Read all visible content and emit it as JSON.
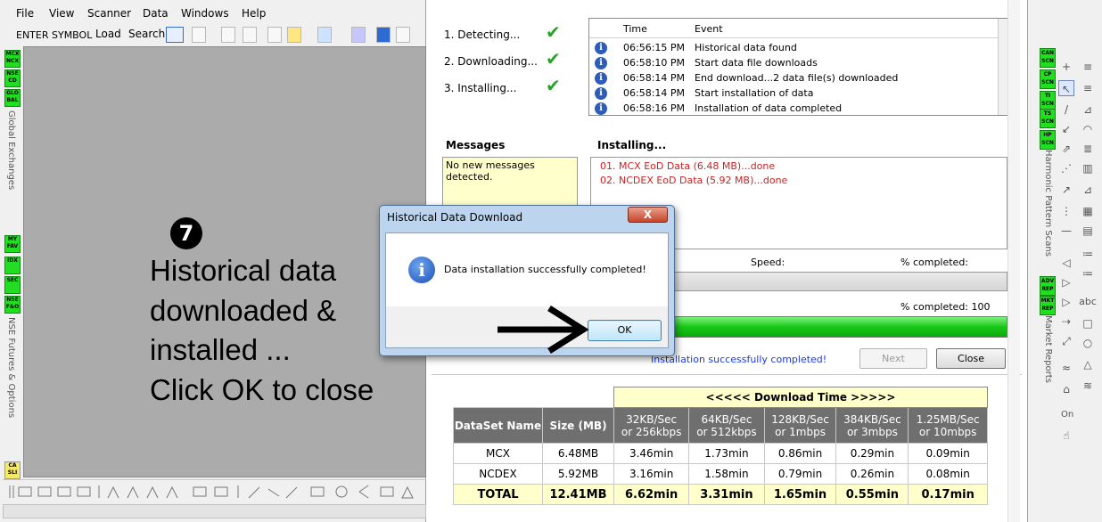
{
  "app": {
    "menu": [
      "File",
      "View",
      "Scanner",
      "Data",
      "Windows",
      "Help"
    ],
    "toolbar": {
      "symbol_input": "ENTER SYMBOL",
      "load": "Load",
      "search": "Search"
    },
    "left_badges": [
      "MCX NCX",
      "NSE CD",
      "GLO BAL",
      "MY FAV",
      "IDX",
      "SEC",
      "NSE F&O",
      "CA SLI"
    ],
    "left_vertical": {
      "global": "Global Exchanges",
      "futures": "NSE Futures & Options"
    }
  },
  "annotation": {
    "step": "7",
    "lines": [
      "Historical data",
      "downloaded &",
      "installed ...",
      "Click OK to close"
    ]
  },
  "installer": {
    "steps": [
      {
        "label": "1.  Detecting..."
      },
      {
        "label": "2.  Downloading..."
      },
      {
        "label": "3.  Installing..."
      }
    ],
    "log_headers": {
      "time": "Time",
      "event": "Event"
    },
    "log": [
      {
        "time": "06:56:15 PM",
        "event": "Historical data found"
      },
      {
        "time": "06:58:10 PM",
        "event": "Start data file downloads"
      },
      {
        "time": "06:58:14 PM",
        "event": "End download...2 data file(s) downloaded"
      },
      {
        "time": "06:58:14 PM",
        "event": "Start installation of data"
      },
      {
        "time": "06:58:16 PM",
        "event": "Installation of data completed"
      }
    ],
    "messages_title": "Messages",
    "messages_text": "No new messages detected.",
    "installing_title": "Installing...",
    "installing_lines": [
      "01. MCX EoD Data (6.48 MB)...done",
      "02. NCDEX EoD Data (5.92 MB)...done"
    ],
    "speed_label": "Speed:",
    "pct_label_1": "% completed:",
    "pct_label_2": "% completed: 100",
    "progress": 1.0,
    "success_msg": "Installation successfully completed!",
    "next": "Next",
    "close": "Close"
  },
  "table": {
    "download_time_header": "<<<<< Download Time >>>>>",
    "col_dataset": "DataSet Name",
    "col_size": "Size (MB)",
    "speeds": [
      [
        "32KB/Sec",
        "or 256kbps"
      ],
      [
        "64KB/Sec",
        "or 512kbps"
      ],
      [
        "128KB/Sec",
        "or 1mbps"
      ],
      [
        "384KB/Sec",
        "or 3mbps"
      ],
      [
        "1.25MB/Sec",
        "or 10mbps"
      ]
    ],
    "rows": [
      [
        "MCX",
        "6.48MB",
        "3.46min",
        "1.73min",
        "0.86min",
        "0.29min",
        "0.09min"
      ],
      [
        "NCDEX",
        "5.92MB",
        "3.16min",
        "1.58min",
        "0.79min",
        "0.26min",
        "0.08min"
      ],
      [
        "TOTAL",
        "12.41MB",
        "6.62min",
        "3.31min",
        "1.65min",
        "0.55min",
        "0.17min"
      ]
    ]
  },
  "dialog": {
    "title": "Historical Data Download",
    "close_glyph": "X",
    "message": "Data installation successfully completed!",
    "ok": "OK"
  },
  "right_panel": {
    "badges": [
      "CAN SCN",
      "CP SCN",
      "TI SCN",
      "TS SCN",
      "HP SCN",
      "ADV REP",
      "MKT REP"
    ],
    "harmonic": "Harmonic Pattern Scans",
    "market": "Market Reports",
    "on_label": "On",
    "abc": "abc"
  }
}
